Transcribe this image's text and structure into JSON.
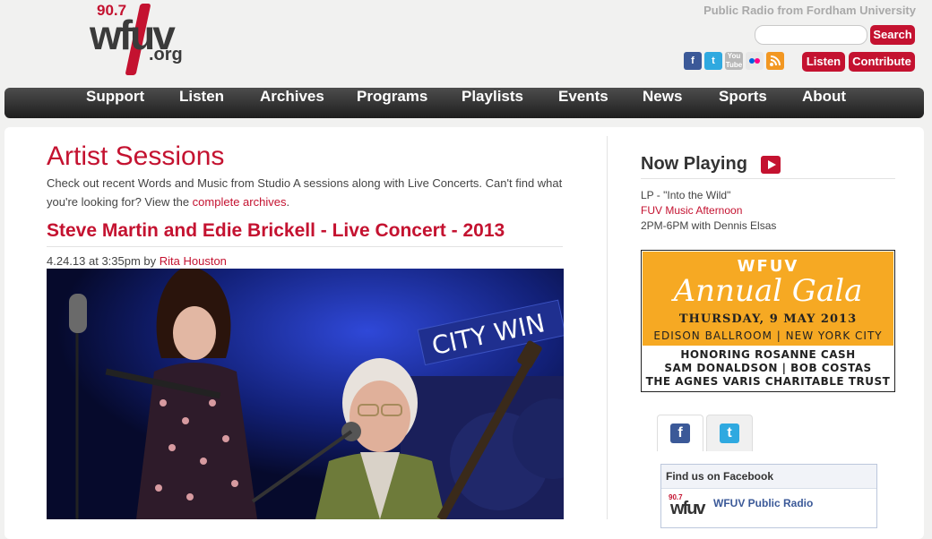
{
  "header": {
    "logo_freq": "90.7",
    "logo_mark": "wfuv",
    "logo_org": ".org",
    "tagline": "Public Radio from Fordham University",
    "search_button": "Search",
    "listen_button": "Listen",
    "contribute_button": "Contribute",
    "social_icons": [
      "facebook-icon",
      "twitter-icon",
      "youtube-icon",
      "flickr-icon",
      "rss-icon"
    ]
  },
  "nav": {
    "items": [
      "Support",
      "Listen",
      "Archives",
      "Programs",
      "Playlists",
      "Events",
      "News",
      "Sports",
      "About"
    ]
  },
  "main": {
    "title": "Artist Sessions",
    "intro_text": "Check out recent Words and Music from Studio A sessions along with Live Concerts. Can't find what you're looking for? View the ",
    "intro_link": "complete archives",
    "intro_end": ".",
    "article_title": "Steve Martin and Edie Brickell - Live Concert - 2013",
    "article_date": "4.24.13 at 3:35pm by ",
    "article_author": "Rita Houston",
    "photo_sign": "CITY WIN"
  },
  "sidebar": {
    "now_playing_title": "Now Playing",
    "track": "LP - \"Into the Wild\"",
    "program": "FUV Music Afternoon",
    "schedule": "2PM-6PM with Dennis Elsas",
    "gala": {
      "line1": "WFUV",
      "line2": "Annual Gala",
      "line3": "THURSDAY, 9 MAY 2013",
      "line4": "EDISON BALLROOM | NEW YORK CITY",
      "honoring1": "HONORING  ROSANNE CASH",
      "honoring2": "SAM DONALDSON | BOB COSTAS",
      "honoring3": "THE AGNES VARIS CHARITABLE TRUST"
    },
    "fb_box_title": "Find us on Facebook",
    "fb_page_name": "WFUV Public Radio",
    "fb_logo_freq": "90.7",
    "fb_logo_mark": "wfuv"
  },
  "colors": {
    "brand_red": "#c41230",
    "nav_dark": "#2a2a2a",
    "facebook_blue": "#3b5998",
    "twitter_blue": "#2fa9e0",
    "gala_orange": "#f6a923"
  }
}
